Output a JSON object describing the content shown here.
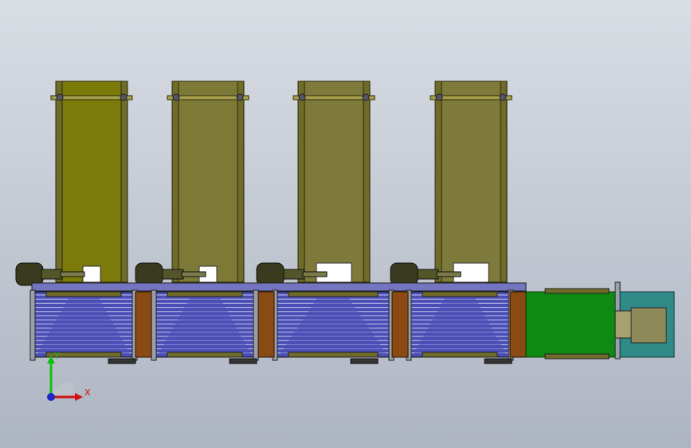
{
  "viewport": {
    "background": [
      "#d9dde4",
      "#aeb5c2"
    ]
  },
  "model": {
    "hoppers": [
      {
        "color": "#7c7a08"
      },
      {
        "color": "#7d7a38"
      },
      {
        "color": "#7e7a3c"
      },
      {
        "color": "#7e7a3c"
      }
    ],
    "frame_color": "#6f6b2a",
    "belt_color": "#4b4fb5",
    "belt_stripe": "#c8c9ee",
    "divider_color": "#8a4a14",
    "exit_conveyor_color": "#0e8a12",
    "exit_box_color": "#2f8a88",
    "motor_color": "#3a3a1e"
  },
  "triad": {
    "x_label": "X",
    "y_label": "Y",
    "x_color": "#d01010",
    "y_color": "#10c010",
    "z_color": "#1c28c8"
  }
}
